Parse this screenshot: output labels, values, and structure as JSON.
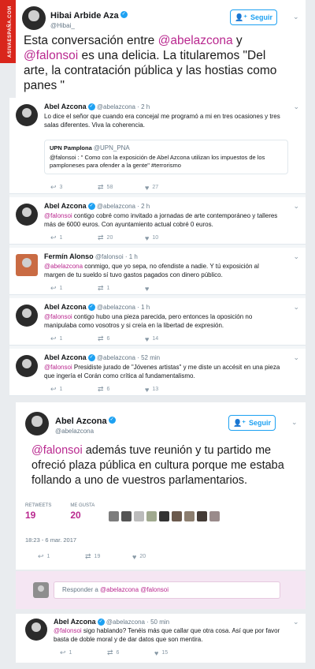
{
  "badge": "ASIVAESPAÑA.COM",
  "header_tweet": {
    "author": "Hibai Arbide Aza",
    "handle": "@Hibai_",
    "follow_label": "Seguir",
    "text_pre": "Esta conversación entre ",
    "mention1": "@abelazcona",
    "text_mid": " y ",
    "mention2": "@falonsoi",
    "text_post": " es una delicia. La titularemos \"Del arte, la contratación pública y las hostias como panes \""
  },
  "thread": [
    {
      "author": "Abel Azcona",
      "handle": "@abelazcona",
      "time": "· 2 h",
      "mention": "",
      "text": "Lo dice el señor que cuando era concejal me programó a mi en tres ocasiones y tres salas diferentes. Viva la coherencia.",
      "quote": {
        "author": "UPN Pamplona",
        "handle": "@UPN_PNA",
        "text": "@falonsoi : \" Como con la exposición de Abel Azcona utilizan los impuestos de los pamploneses para ofender a la gente\" #terrorismo"
      },
      "replies": "3",
      "retweets": "58",
      "likes": "27"
    },
    {
      "author": "Abel Azcona",
      "handle": "@abelazcona",
      "time": "· 2 h",
      "mention": "@falonsoi",
      "text": " contigo cobré como invitado a jornadas de arte contemporáneo y talleres más de 6000 euros. Con ayuntamiento actual cobré 0 euros.",
      "replies": "1",
      "retweets": "20",
      "likes": "10"
    },
    {
      "author": "Fermín Alonso",
      "handle": "@falonsoi",
      "time": "· 1 h",
      "mention": "@abelazcona",
      "text": " conmigo, que yo sepa, no ofendiste a nadie. Y tú exposición al margen de tu sueldo sí tuvo gastos pagados con dinero público.",
      "replies": "1",
      "retweets": "1",
      "likes": ""
    },
    {
      "author": "Abel Azcona",
      "handle": "@abelazcona",
      "time": "· 1 h",
      "mention": "@falonsoi",
      "text": " contigo hubo una pieza parecida, pero entonces la oposición no manipulaba como vosotros y si creía en la libertad de expresión.",
      "replies": "1",
      "retweets": "6",
      "likes": "14"
    },
    {
      "author": "Abel Azcona",
      "handle": "@abelazcona",
      "time": "· 52 min",
      "mention": "@falonsoi",
      "text": " Presidiste jurado de \"Jóvenes artistas\" y me diste un accésit en una pieza que ingería el Corán como crítica al fundamentalismo.",
      "replies": "1",
      "retweets": "6",
      "likes": "13"
    }
  ],
  "focus_tweet": {
    "author": "Abel Azcona",
    "handle": "@abelazcona",
    "follow_label": "Seguir",
    "mention": "@falonsoi",
    "text": " además tuve reunión y tu partido me ofreció plaza pública en cultura porque me estaba follando a uno de vuestros parlamentarios.",
    "retweets_label": "RETWEETS",
    "retweets": "19",
    "likes_label": "ME GUSTA",
    "likes": "20",
    "timestamp": "18:23 - 6 mar. 2017",
    "action_replies": "1",
    "action_retweets": "19",
    "action_likes": "20"
  },
  "reply_box": {
    "placeholder": "Responder a ",
    "mention1": "@abelazcona",
    "mention2": " @falonsoi"
  },
  "last_tweet": {
    "author": "Abel Azcona",
    "handle": "@abelazcona",
    "time": "· 50 min",
    "mention": "@falonsoi",
    "text": " sigo hablando? Tenéis más que callar que otra cosa. Así que por favor basta de doble moral y de dar datos que son mentira.",
    "replies": "1",
    "retweets": "6",
    "likes": "15"
  },
  "colors": {
    "accent": "#1da1f2",
    "mention": "#b9288f",
    "badge": "#d9261c",
    "reply_bg": "#f5e6f3"
  }
}
